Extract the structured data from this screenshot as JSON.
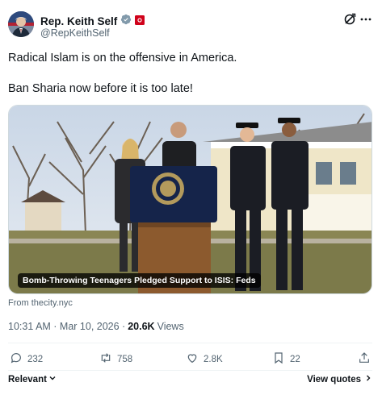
{
  "author": {
    "display_name": "Rep. Keith Self",
    "handle": "@RepKeithSelf",
    "verified_badge": "verified-badge-icon",
    "affiliation_badge": "flag-badge-icon"
  },
  "tweet": {
    "line1": "Radical Islam is on the offensive in America.",
    "line2": "Ban Sharia now before it is too late!"
  },
  "media": {
    "caption": "Bomb-Throwing Teenagers Pledged Support to ISIS: Feds",
    "source": "From thecity.nyc"
  },
  "meta": {
    "time": "10:31 AM · Mar 10, 2026 ·",
    "views_count": "20.6K",
    "views_label": "Views"
  },
  "actions": {
    "replies": "232",
    "reposts": "758",
    "likes": "2.8K",
    "bookmarks": "22"
  },
  "footer": {
    "relevant": "Relevant",
    "view_quotes": "View quotes"
  },
  "colors": {
    "text": "#0f1419",
    "secondary": "#536471",
    "verified": "#829aab",
    "badge_red": "#d0021b"
  }
}
